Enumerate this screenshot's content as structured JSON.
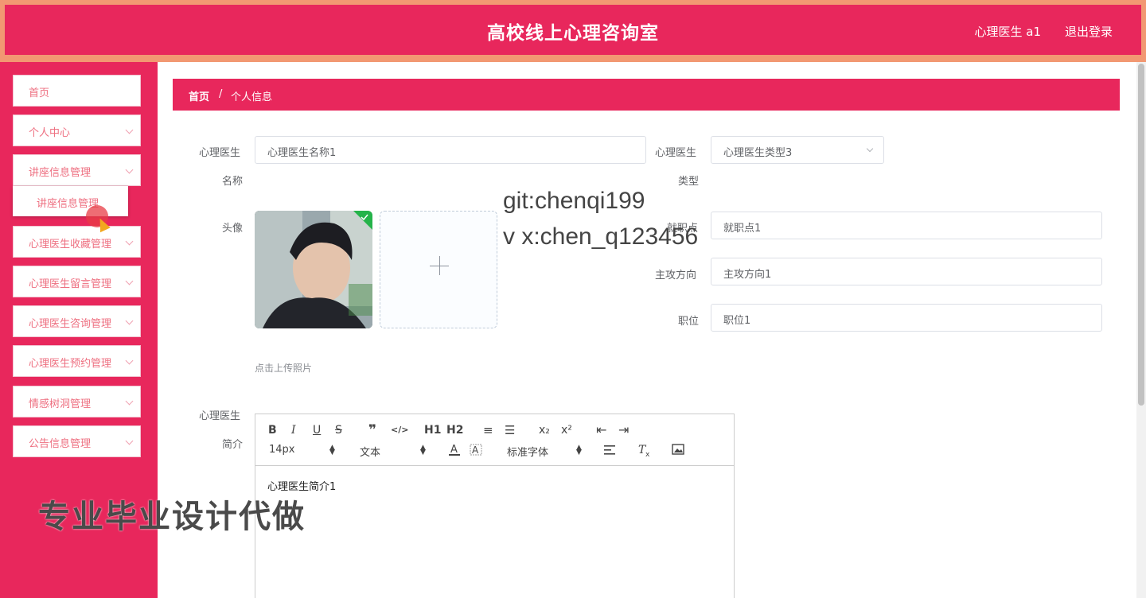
{
  "header": {
    "title": "高校线上心理咨询室",
    "user": "心理医生 a1",
    "logout": "退出登录",
    "colors": {
      "primary": "#e8275c",
      "border": "#f29872"
    }
  },
  "sidebar": {
    "items": [
      {
        "label": "首页"
      },
      {
        "label": "个人中心"
      },
      {
        "label": "讲座信息管理"
      },
      {
        "label": "心理医生收藏管理"
      },
      {
        "label": "心理医生留言管理"
      },
      {
        "label": "心理医生咨询管理"
      },
      {
        "label": "心理医生预约管理"
      },
      {
        "label": "情感树洞管理"
      },
      {
        "label": "公告信息管理"
      }
    ],
    "submenu": {
      "label": "讲座信息管理"
    }
  },
  "breadcrumb": {
    "home": "首页",
    "separator": "/",
    "current": "个人信息"
  },
  "form": {
    "name_label_1": "心理医生",
    "name_label_2": "名称",
    "name_value": "心理医生名称1",
    "type_label_1": "心理医生",
    "type_label_2": "类型",
    "type_value": "心理医生类型3",
    "avatar_label": "头像",
    "upload_hint": "点击上传照片",
    "workplace_label": "就职点",
    "workplace_value": "就职点1",
    "direction_label": "主攻方向",
    "direction_value": "主攻方向1",
    "position_label": "职位",
    "position_value": "职位1",
    "intro_label_1": "心理医生",
    "intro_label_2": "简介"
  },
  "editor": {
    "toolbar": {
      "bold": "B",
      "italic": "I",
      "underline": "U",
      "strike": "S",
      "quote": "❞",
      "code": "</>",
      "h1": "H1",
      "h2": "H2",
      "ordered": "≡",
      "bullet": "☰",
      "sub": "x₂",
      "sup": "x²",
      "outdent": "⇤",
      "indent": "⇥",
      "size": "14px",
      "style": "文本",
      "font": "标准字体"
    },
    "content": "心理医生简介1"
  },
  "watermarks": {
    "line1": "git:chenqi199",
    "line2": "v x:chen_q123456",
    "line3": "专业毕业设计代做"
  }
}
